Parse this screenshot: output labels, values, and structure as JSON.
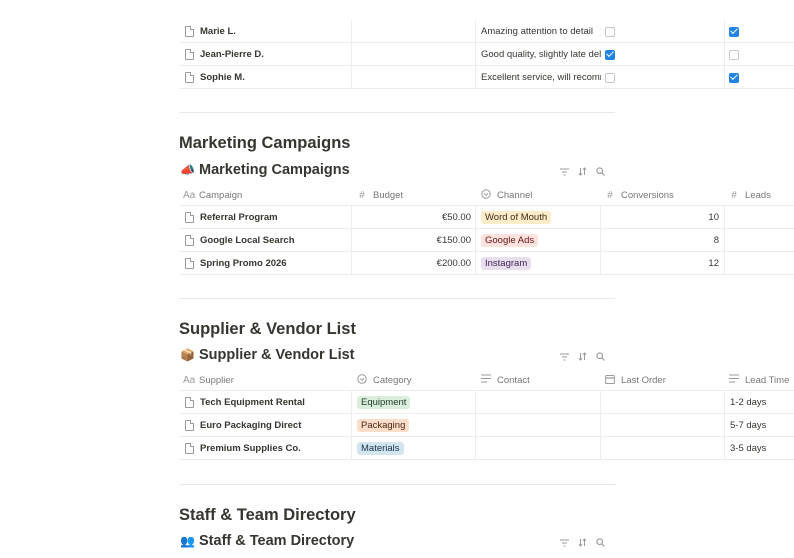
{
  "reviews": {
    "rows": [
      {
        "name": "Marie L.",
        "feedback": "Amazing attention to detail",
        "check1": false,
        "check2": true
      },
      {
        "name": "Jean-Pierre D.",
        "feedback": "Good quality, slightly late delivery",
        "check1": true,
        "check2": false
      },
      {
        "name": "Sophie M.",
        "feedback": "Excellent service, will recommend",
        "check1": false,
        "check2": true
      }
    ]
  },
  "marketing": {
    "heading": "Marketing Campaigns",
    "db_title": "Marketing Campaigns",
    "emoji": "📣",
    "columns": {
      "campaign": "Campaign",
      "budget": "Budget",
      "channel": "Channel",
      "conversions": "Conversions",
      "leads": "Leads"
    },
    "rows": [
      {
        "name": "Referral Program",
        "budget": "€50.00",
        "channel": "Word of Mouth",
        "channel_bg": "#fdecc8",
        "channel_fg": "#402c1b",
        "conversions": "10"
      },
      {
        "name": "Google Local Search",
        "budget": "€150.00",
        "channel": "Google Ads",
        "channel_bg": "#ffe2dd",
        "channel_fg": "#5d1715",
        "conversions": "8"
      },
      {
        "name": "Spring Promo 2026",
        "budget": "€200.00",
        "channel": "Instagram",
        "channel_bg": "#e8deee",
        "channel_fg": "#412454",
        "conversions": "12"
      }
    ]
  },
  "supplier": {
    "heading": "Supplier & Vendor List",
    "db_title": "Supplier & Vendor List",
    "emoji": "📦",
    "columns": {
      "supplier": "Supplier",
      "category": "Category",
      "contact": "Contact",
      "last_order": "Last Order",
      "lead_time": "Lead Time"
    },
    "rows": [
      {
        "name": "Tech Equipment Rental",
        "category": "Equipment",
        "category_bg": "#dbeddb",
        "category_fg": "#1c3829",
        "lead_time": "1-2 days"
      },
      {
        "name": "Euro Packaging Direct",
        "category": "Packaging",
        "category_bg": "#fadec9",
        "category_fg": "#49290e",
        "lead_time": "5-7 days"
      },
      {
        "name": "Premium Supplies Co.",
        "category": "Materials",
        "category_bg": "#d3e5ef",
        "category_fg": "#183347",
        "lead_time": "3-5 days"
      }
    ]
  },
  "staff": {
    "heading": "Staff & Team Directory",
    "db_title": "Staff & Team Directory",
    "emoji": "👥"
  },
  "icons": {
    "filter": "filter-icon",
    "sort": "sort-icon",
    "search": "search-icon",
    "page": "page-icon"
  }
}
